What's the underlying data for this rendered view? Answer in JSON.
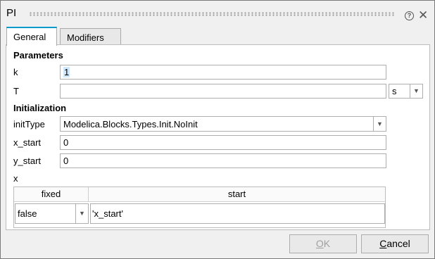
{
  "window": {
    "title": "PI"
  },
  "tabs": [
    {
      "label": "General"
    },
    {
      "label": "Modifiers"
    }
  ],
  "parameters": {
    "heading": "Parameters",
    "k": {
      "label": "k",
      "value": "1"
    },
    "T": {
      "label": "T",
      "value": "",
      "unit": "s"
    }
  },
  "initialization": {
    "heading": "Initialization",
    "initType": {
      "label": "initType",
      "value": "Modelica.Blocks.Types.Init.NoInit"
    },
    "x_start": {
      "label": "x_start",
      "value": "0"
    },
    "y_start": {
      "label": "y_start",
      "value": "0"
    },
    "x": {
      "label": "x",
      "columns": [
        "fixed",
        "start"
      ],
      "row": {
        "fixed": "false",
        "start": "'x_start'"
      }
    }
  },
  "buttons": {
    "ok": {
      "pre": "",
      "accel": "O",
      "post": "K",
      "enabled": false
    },
    "cancel": {
      "pre": "",
      "accel": "C",
      "post": "ancel"
    }
  }
}
